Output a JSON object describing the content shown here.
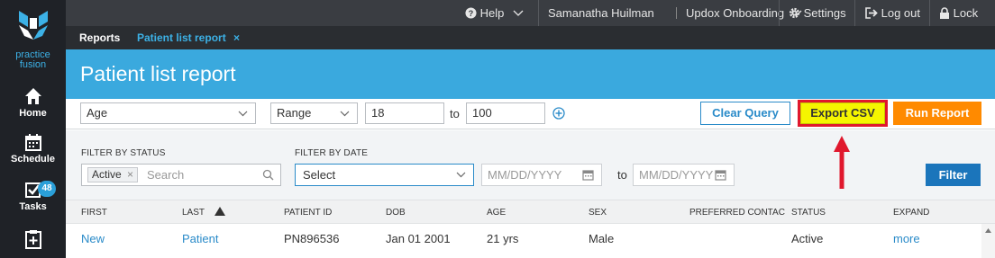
{
  "sidebar": {
    "logo_line1": "practice",
    "logo_line2": "fusion",
    "items": [
      {
        "label": "Home",
        "icon": "home-icon"
      },
      {
        "label": "Schedule",
        "icon": "calendar-icon"
      },
      {
        "label": "Tasks",
        "icon": "tasks-icon",
        "badge": "48"
      },
      {
        "label": "",
        "icon": "clipboard-icon"
      }
    ]
  },
  "topbar": {
    "help": "Help",
    "user": "Samanatha Huilman",
    "org": "Updox Onboarding",
    "settings": "Settings",
    "logout": "Log out",
    "lock": "Lock"
  },
  "tabs": {
    "reports": "Reports",
    "active_tab": "Patient list report",
    "close": "×"
  },
  "page": {
    "title": "Patient list report"
  },
  "query": {
    "field": "Age",
    "operator": "Range",
    "from": "18",
    "to_label": "to",
    "to": "100",
    "clear_label": "Clear Query",
    "export_label": "Export CSV",
    "run_label": "Run Report"
  },
  "filters": {
    "status_label": "FILTER BY STATUS",
    "status_tag": "Active",
    "status_tag_remove": "×",
    "search_placeholder": "Search",
    "date_label": "FILTER BY DATE",
    "date_select": "Select",
    "date_from_placeholder": "MM/DD/YYYY",
    "date_to_label": "to",
    "date_to_placeholder": "MM/DD/YYYY",
    "filter_button": "Filter"
  },
  "table": {
    "columns": [
      "FIRST",
      "LAST",
      "PATIENT ID",
      "DOB",
      "AGE",
      "SEX",
      "PREFERRED CONTAC",
      "STATUS",
      "EXPAND"
    ],
    "rows": [
      {
        "first": "New",
        "last": "Patient",
        "patient_id": "PN896536",
        "dob": "Jan 01 2001",
        "age": "21 yrs",
        "sex": "Male",
        "preferred_contact": "",
        "status": "Active",
        "expand": "more"
      }
    ]
  },
  "colors": {
    "brand_blue": "#3aa9de",
    "export_fill": "#f5f500",
    "callout_red": "#e0182d",
    "run_orange": "#ff8a00",
    "filter_blue": "#1b75bb"
  }
}
